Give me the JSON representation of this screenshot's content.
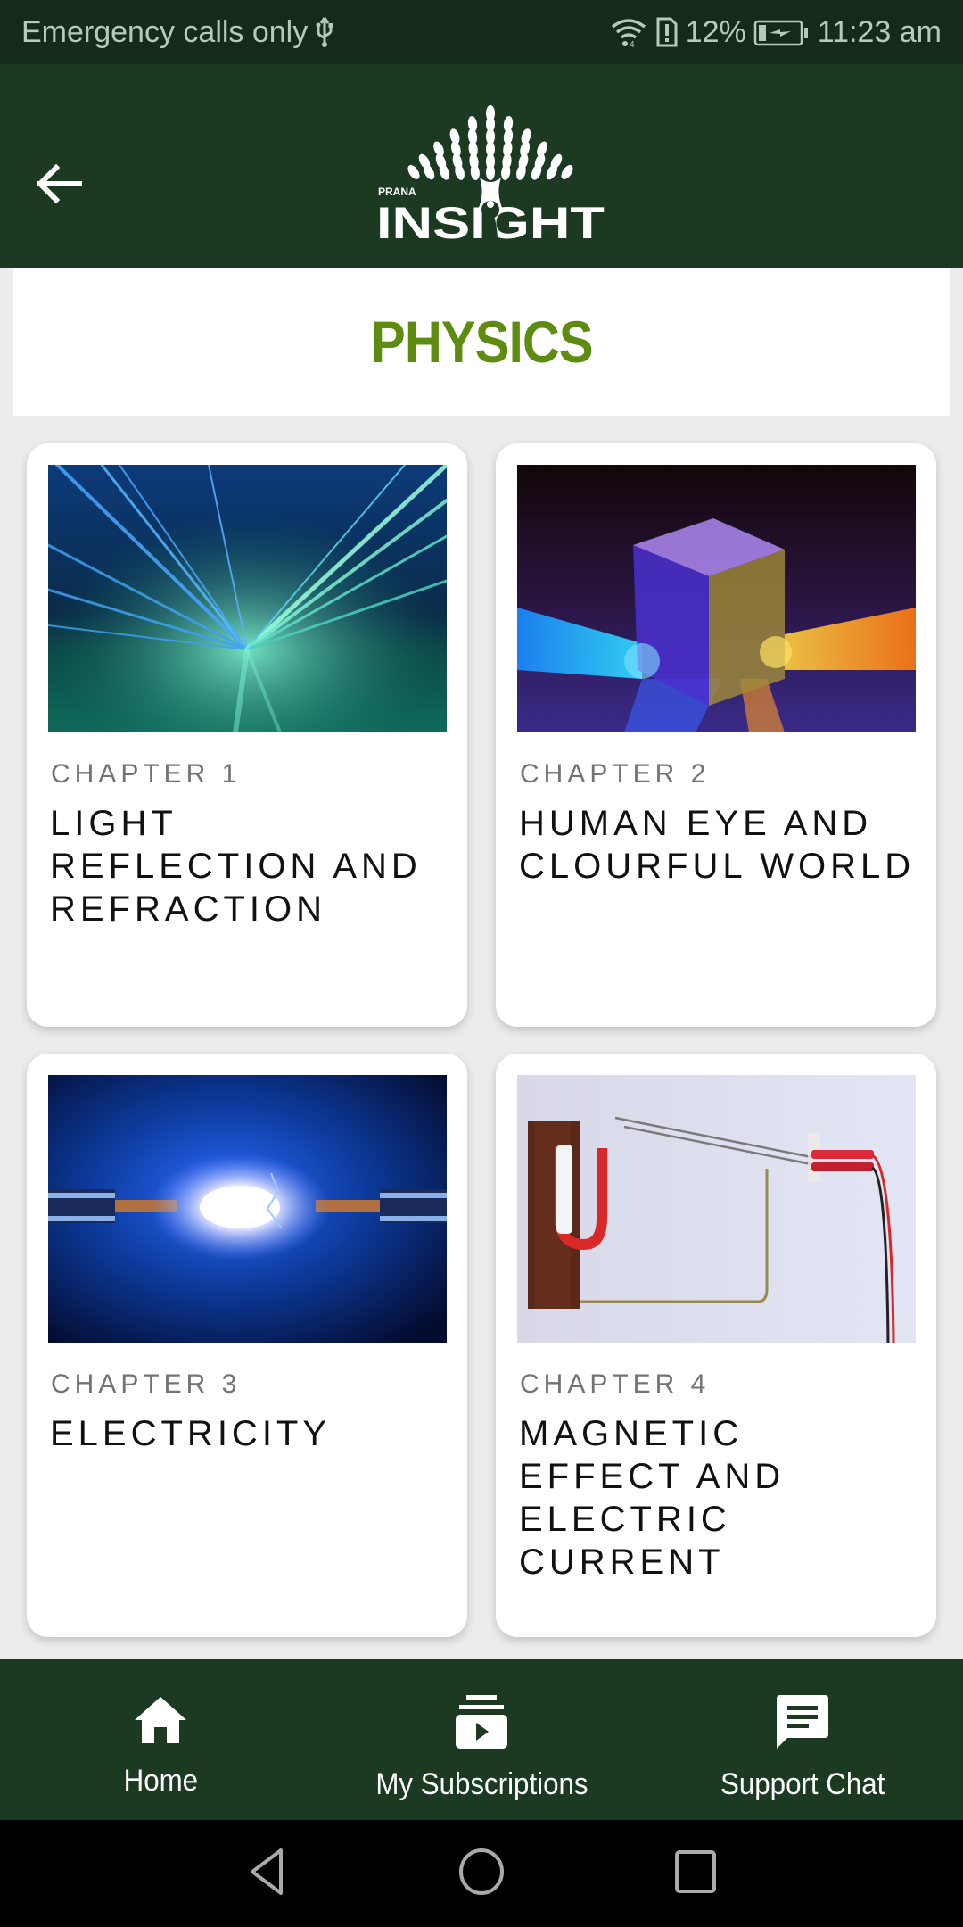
{
  "status_bar": {
    "carrier_text": "Emergency calls only",
    "battery_percent": "12%",
    "time": "11:23 am",
    "icons": [
      "usb-icon",
      "wifi-icon",
      "sim-alert-icon",
      "battery-charging-icon"
    ]
  },
  "app_bar": {
    "back_icon": "arrow-left-icon",
    "logo_small_text": "PRANA",
    "logo_text": "INSIGHT"
  },
  "page": {
    "title": "PHYSICS",
    "title_color": "#5e8c11"
  },
  "chapters": [
    {
      "chapter_label": "CHAPTER 1",
      "title": "LIGHT REFLECTION AND REFRACTION",
      "image": "laser-beams-image"
    },
    {
      "chapter_label": "CHAPTER 2",
      "title": "HUMAN EYE AND CLOURFUL WORLD",
      "image": "prism-light-image"
    },
    {
      "chapter_label": "CHAPTER 3",
      "title": "ELECTRICITY",
      "image": "electric-spark-image"
    },
    {
      "chapter_label": "CHAPTER 4",
      "title": "MAGNETIC EFFECT AND ELECTRIC CURRENT",
      "image": "magnet-apparatus-image"
    }
  ],
  "bottom_nav": {
    "items": [
      {
        "label": "Home",
        "icon": "home-icon"
      },
      {
        "label": "My Subscriptions",
        "icon": "subscriptions-icon"
      },
      {
        "label": "Support Chat",
        "icon": "chat-icon"
      }
    ]
  },
  "system_nav": {
    "buttons": [
      "back-triangle-icon",
      "home-circle-icon",
      "recents-square-icon"
    ]
  },
  "colors": {
    "app_bar": "#1b3a21",
    "status_bar": "#142b1c",
    "background": "#ececec"
  }
}
